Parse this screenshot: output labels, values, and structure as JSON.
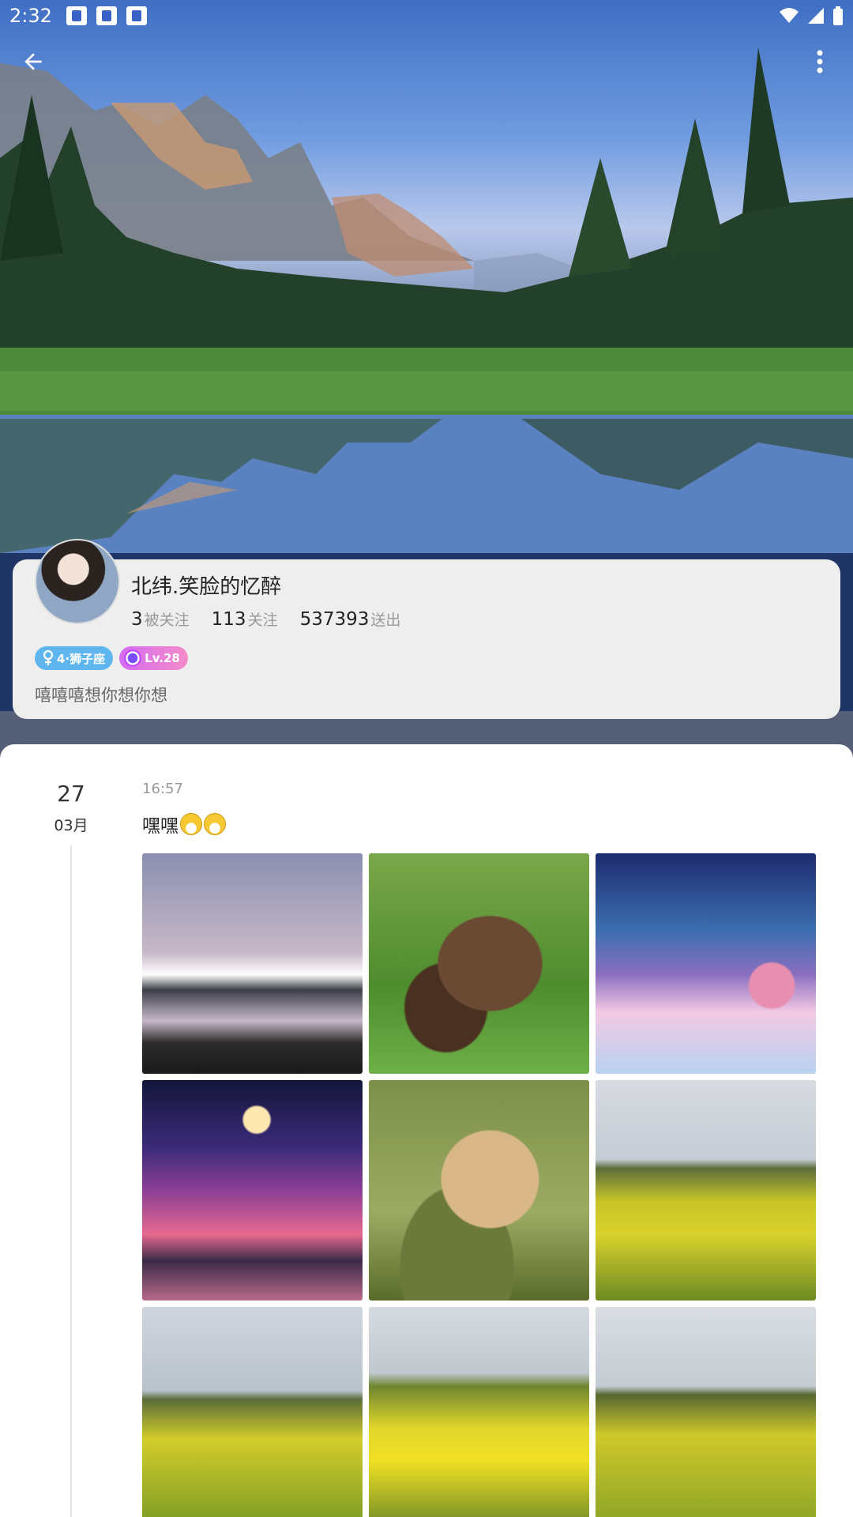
{
  "status_bar": {
    "time": "2:32",
    "notification_icons": [
      "app-notification-icon",
      "app-notification-icon",
      "app-notification-icon"
    ]
  },
  "toolbar": {
    "back_icon": "arrow-left-icon",
    "more_icon": "more-vertical-icon"
  },
  "profile": {
    "nickname": "北纬.笑脸的忆醉",
    "stats": [
      {
        "value": "3",
        "label": "被关注"
      },
      {
        "value": "113",
        "label": "关注"
      },
      {
        "value": "537393",
        "label": "送出"
      }
    ],
    "badges": {
      "zodiac": "4·狮子座",
      "level": "Lv.28"
    },
    "bio": "嘻嘻嘻想你想你想"
  },
  "post": {
    "date_day": "27",
    "date_month": "03月",
    "time": "16:57",
    "text": "嘿嘿",
    "emoji_icons": [
      "grinning-face-icon",
      "grinning-face-icon"
    ],
    "photos": [
      "mountain-lake-photo",
      "bears-photo",
      "fantasy-night-sky-photo",
      "crescent-moon-island-photo",
      "lioness-photo",
      "rapeseed-field-photo",
      "rapeseed-field-photo",
      "rapeseed-flowers-photo",
      "rapeseed-field-photo"
    ]
  }
}
